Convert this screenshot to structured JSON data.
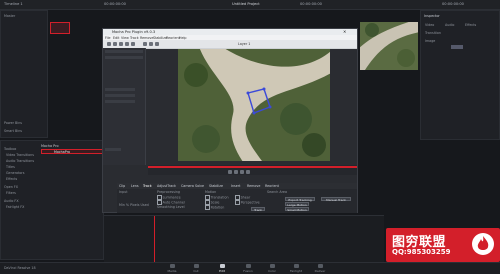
{
  "app": {
    "title": "Untitled Project",
    "clip_label_left": "Timeline 1",
    "timecode_left": "00:00:00:00",
    "timecode_center": "00:00:00:00",
    "timecode_right": "00:00:00:00"
  },
  "left_panel": {
    "items": [
      "Master",
      "Power Bins",
      "Smart Bins"
    ]
  },
  "effects_panel": {
    "header": "Mocha Pro",
    "selected": "MochaPro",
    "items": [
      "Toolbox",
      "Video Transitions",
      "Audio Transitions",
      "Titles",
      "Generators",
      "Effects",
      "Open FX",
      "Filters",
      "Audio FX",
      "Fairlight FX"
    ]
  },
  "mocha_window": {
    "title": "Mocha Pro Plugin v9.0.3",
    "menu": [
      "File",
      "Edit",
      "View",
      "Track",
      "Remove",
      "Stabilize",
      "Reorient",
      "Help"
    ],
    "layer_label": "Layer 1",
    "tabs": [
      "Clip",
      "Lens",
      "Track",
      "AdjustTrack",
      "Camera Solve",
      "Stabilize",
      "Insert",
      "Remove",
      "Reorient"
    ],
    "tracking_data": {
      "input_label": "Input",
      "preprocessing_label": "Preprocessing",
      "motion_label": "Motion",
      "search_area_label": "Search Area",
      "options": [
        "Luminance",
        "Auto Channel",
        "Min % Pixels Used",
        "Smoothing Level"
      ],
      "motion_options": [
        "Translation",
        "Scale",
        "Rotation",
        "Shear",
        "Perspective"
      ],
      "buttons": [
        "Track",
        "Export Tracking Data",
        "Large Motion",
        "Small Motion",
        "Manual Track"
      ]
    }
  },
  "right_panel": {
    "header": "Inspector",
    "items": [
      "Video",
      "Audio",
      "Effects",
      "Transition",
      "Image"
    ]
  },
  "bottom_nav": [
    "Media",
    "Cut",
    "Edit",
    "Fusion",
    "Color",
    "Fairlight",
    "Deliver"
  ],
  "bottom_left": "DaVinci Resolve 18",
  "watermark": {
    "title": "图穷联盟",
    "qq": "QQ:985303259"
  },
  "colors": {
    "accent_red": "#d31f2a",
    "bg": "#16181c",
    "track_blue": "#3b4ad9"
  }
}
